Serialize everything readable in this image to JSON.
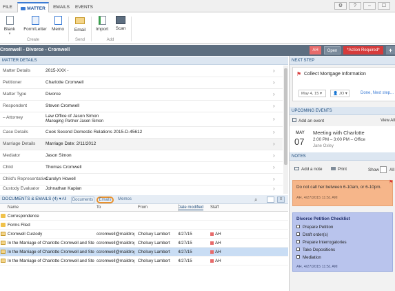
{
  "ribbon": {
    "tabs": [
      "FILE",
      "MATTER",
      "EMAILS",
      "EVENTS"
    ],
    "window_buttons": [
      "⚙",
      "?",
      "–",
      "☐"
    ],
    "create": [
      "Blank",
      "Form/Letter",
      "Memo"
    ],
    "send": [
      "Email"
    ],
    "add": [
      "Import",
      "Scan"
    ],
    "groups": [
      "Create",
      "Send",
      "Add"
    ]
  },
  "titlebar": {
    "title": "Cromwell - Divorce - Cromwell",
    "badge": "AH",
    "status": "Open",
    "action": "*Action Required*",
    "plus": "+"
  },
  "matter": {
    "heading": "MATTER DETAILS",
    "rows": [
      {
        "label": "Matter Details",
        "value": "2015-XXX -"
      },
      {
        "label": "Petitioner",
        "value": "Charlotte Cromwell"
      },
      {
        "label": "Matter Type",
        "value": "Divorce"
      },
      {
        "label": "Respondent",
        "value": "Steven Cromwell"
      },
      {
        "label": "– Attorney",
        "value": "Law Office of Jason Simon",
        "value2_role": "Managing Partner",
        "value2_name": "Jason Simon"
      },
      {
        "label": "Case Details",
        "value": "Cook Second Domestic Relations 2015-D-45612"
      },
      {
        "label": "Marriage Details",
        "value": "Marriage Date: 2/11/2012"
      },
      {
        "label": "Mediator",
        "value": "Jason Simon"
      },
      {
        "label": "Child",
        "value": "Thomas Cromwell"
      },
      {
        "label": "Child's Representative",
        "value": "Carolyn Howell"
      },
      {
        "label": "Custody Evaluator",
        "value": "Johnathan Kaplan"
      }
    ]
  },
  "docs": {
    "heading": "DOCUMENTS & EMAILS (4)",
    "filters": [
      "All",
      "Documents",
      "Emails",
      "Memos"
    ],
    "columns": [
      "Name",
      "To",
      "From",
      "Date modified",
      "Staff"
    ],
    "rows": [
      {
        "name": "Correspondence",
        "to": "",
        "from": "",
        "date": "",
        "staff": ""
      },
      {
        "name": "Forms Filed",
        "to": "",
        "from": "",
        "date": "",
        "staff": ""
      },
      {
        "name": "Cromwell Custody",
        "to": "ccromwell@maildrop",
        "from": "Chelsey Lambert",
        "date": "4/27/15",
        "staff": "AH"
      },
      {
        "name": "In the Marriage of Charlotte Cromwell and Ste...",
        "to": "ccromwell@maildrop",
        "from": "Chelsey Lambert",
        "date": "4/27/15",
        "staff": "AH"
      },
      {
        "name": "In the Marriage of Charlotte Cromwell and Ste...",
        "to": "ccromwell@maildrop",
        "from": "Chelsey Lambert",
        "date": "4/27/15",
        "staff": "AH"
      },
      {
        "name": "In the Marriage of Charlotte Cromwell and Ste...",
        "to": "ccromwell@maildrop",
        "from": "Chelsey Lambert",
        "date": "4/27/15",
        "staff": "AH"
      }
    ]
  },
  "next_step": {
    "heading": "NEXT STEP",
    "title": "Collect Mortgage Information",
    "date": "May 4, 15",
    "assignee": "JO",
    "done": "Done, Next step..."
  },
  "events": {
    "heading": "UPCOMING EVENTS",
    "add": "Add an event",
    "view_all": "View All",
    "month": "MAY",
    "day": "07",
    "title": "Meeting with Charlotte",
    "time": "2:00 PM – 3:00 PM – Office",
    "who": "Jane Oxley"
  },
  "notes": {
    "heading": "NOTES",
    "add": "Add a note",
    "print": "Print",
    "show": "Show",
    "all": "All",
    "note1": {
      "text": "Do not call her between 6-10am, or 6-10pm.",
      "meta": "AH, 4/27/2015 11:51 AM"
    },
    "note2": {
      "title": "Divorce Petition Checklist",
      "items": [
        "Prepare Petition",
        "Draft order(s)",
        "Prepare Interrogatories",
        "Take Depositions",
        "Mediation"
      ],
      "meta": "AH, 4/27/2015 11:51 AM"
    }
  }
}
